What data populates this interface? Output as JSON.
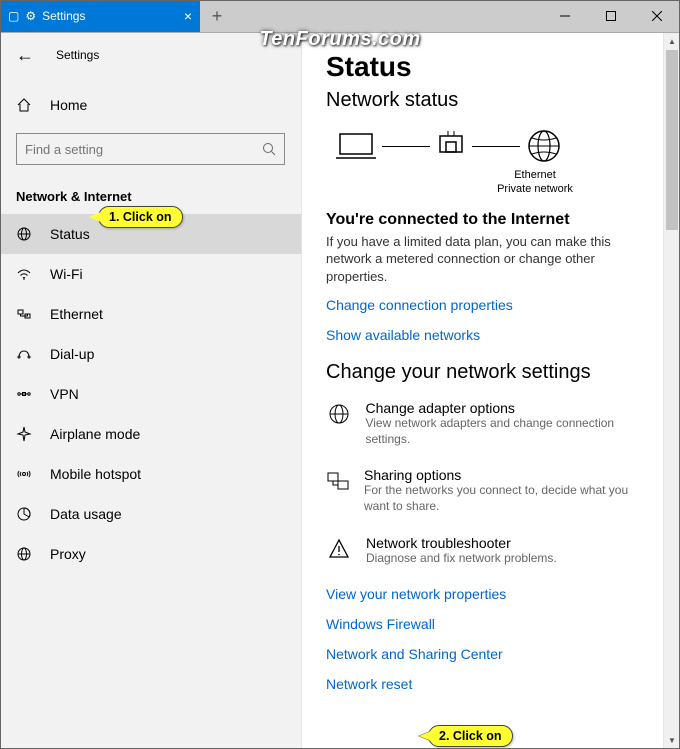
{
  "titlebar": {
    "tab_label": "Settings",
    "watermark": "TenForums.com"
  },
  "sidebar": {
    "back_title": "Settings",
    "home_label": "Home",
    "search_placeholder": "Find a setting",
    "category": "Network & Internet",
    "items": [
      {
        "label": "Status",
        "selected": true
      },
      {
        "label": "Wi-Fi"
      },
      {
        "label": "Ethernet"
      },
      {
        "label": "Dial-up"
      },
      {
        "label": "VPN"
      },
      {
        "label": "Airplane mode"
      },
      {
        "label": "Mobile hotspot"
      },
      {
        "label": "Data usage"
      },
      {
        "label": "Proxy"
      }
    ]
  },
  "main": {
    "title": "Status",
    "subtitle": "Network status",
    "diag_label1": "Ethernet",
    "diag_label2": "Private network",
    "connected_heading": "You're connected to the Internet",
    "connected_body": "If you have a limited data plan, you can make this network a metered connection or change other properties.",
    "link_change_conn": "Change connection properties",
    "link_show_avail": "Show available networks",
    "change_settings_heading": "Change your network settings",
    "options": [
      {
        "title": "Change adapter options",
        "desc": "View network adapters and change connection settings."
      },
      {
        "title": "Sharing options",
        "desc": "For the networks you connect to, decide what you want to share."
      },
      {
        "title": "Network troubleshooter",
        "desc": "Diagnose and fix network problems."
      }
    ],
    "link_view_props": "View your network properties",
    "link_firewall": "Windows Firewall",
    "link_sharing_center": "Network and Sharing Center",
    "link_reset": "Network reset"
  },
  "callouts": {
    "c1": "1. Click on",
    "c2": "2. Click on"
  }
}
